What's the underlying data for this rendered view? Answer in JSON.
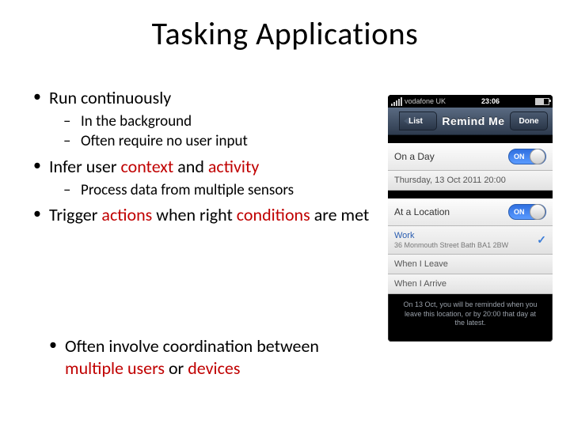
{
  "title": "Tasking Applications",
  "bullets": {
    "b1": "Run continuously",
    "b1a": "In the background",
    "b1b": "Often require no user input",
    "b2_pre": "Infer user ",
    "b2_hl1": "context",
    "b2_mid": " and ",
    "b2_hl2": "activity",
    "b2a": "Process data from multiple sensors",
    "b3_pre": "Trigger ",
    "b3_hl1": "actions",
    "b3_mid": " when right ",
    "b3_hl2": "conditions",
    "b3_post": " are met",
    "b4_pre": "Often involve coordination between ",
    "b4_hl1": "multiple users",
    "b4_mid": " or ",
    "b4_hl2": "devices"
  },
  "phone": {
    "carrier": "vodafone UK",
    "clock": "23:06",
    "nav_back": "List",
    "nav_title": "Remind Me",
    "nav_done": "Done",
    "on_day": "On a Day",
    "on_day_value": "Thursday, 13 Oct 2011 20:00",
    "at_location": "At a Location",
    "work_label": "Work",
    "work_addr": "36 Monmouth Street Bath BA1 2BW",
    "when_leave": "When I Leave",
    "when_arrive": "When I Arrive",
    "toggle_on": "ON",
    "footer": "On 13 Oct, you will be reminded when you leave this location, or by 20:00 that day at the latest."
  }
}
